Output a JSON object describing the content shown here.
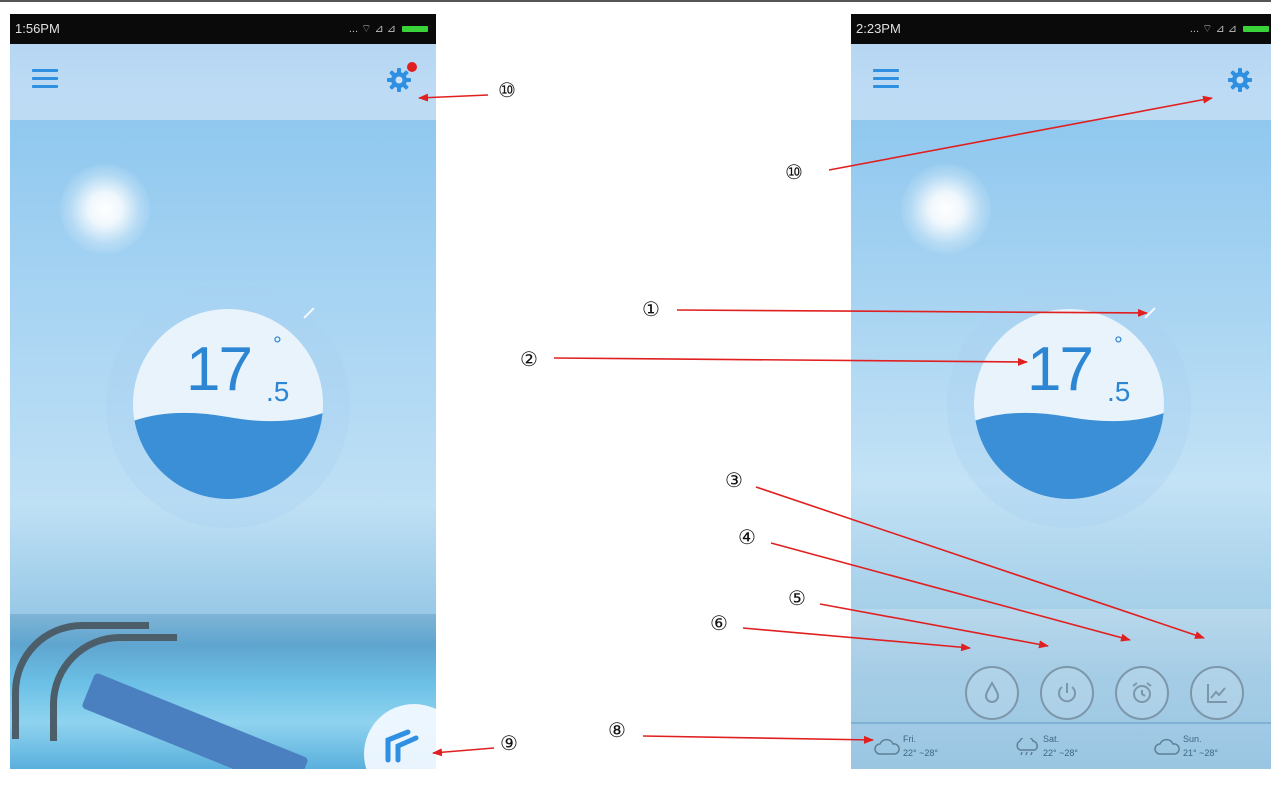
{
  "left_screen": {
    "status_time": "1:56PM",
    "status_icons": "... ⌔ ⊿ ⊿",
    "temperature_integer": "17",
    "temperature_degree": "°",
    "temperature_decimal": ".5"
  },
  "right_screen": {
    "status_time": "2:23PM",
    "status_icons": "... ⌔ ⊿ ⊿",
    "temperature_integer": "17",
    "temperature_degree": "°",
    "temperature_decimal": ".5",
    "forecast": [
      {
        "day": "Fri.",
        "range": "22° ~28°",
        "icon": "cloud-icon"
      },
      {
        "day": "Sat.",
        "range": "22° ~28°",
        "icon": "cloud-rain-icon"
      },
      {
        "day": "Sun.",
        "range": "21° ~28°",
        "icon": "cloud-icon"
      }
    ],
    "function_buttons": [
      "water-drop-icon",
      "power-icon",
      "alarm-clock-icon",
      "chart-icon"
    ]
  },
  "callouts": {
    "c1": "①",
    "c2": "②",
    "c3": "③",
    "c4": "④",
    "c5": "⑤",
    "c6": "⑥",
    "c8": "⑧",
    "c9": "⑨",
    "c10_left": "⑩",
    "c10_right": "⑩"
  },
  "colors": {
    "accent_blue": "#2f8fe0",
    "arrow_red": "#e02020",
    "notification_red": "#e02020"
  }
}
